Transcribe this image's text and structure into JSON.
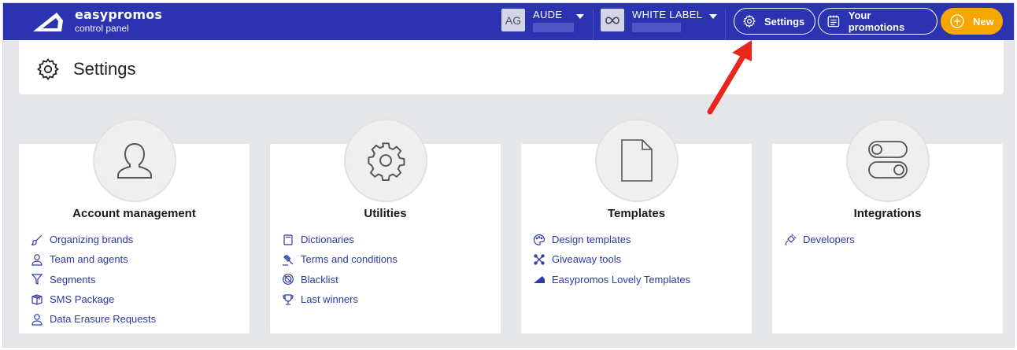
{
  "brand": {
    "name": "easypromos",
    "subtitle": "control panel"
  },
  "account": {
    "initials": "AG",
    "name": "AUDE"
  },
  "label": {
    "name": "WHITE LABEL"
  },
  "nav": {
    "settings": "Settings",
    "promotions": "Your promotions",
    "new": "New"
  },
  "page": {
    "title": "Settings"
  },
  "cards": [
    {
      "title": "Account management",
      "icon": "user-icon",
      "links": [
        {
          "label": "Organizing brands",
          "icon": "brush-icon"
        },
        {
          "label": "Team and agents",
          "icon": "user-icon"
        },
        {
          "label": "Segments",
          "icon": "filter-icon"
        },
        {
          "label": "SMS Package",
          "icon": "package-icon"
        },
        {
          "label": "Data Erasure Requests",
          "icon": "user-icon"
        }
      ]
    },
    {
      "title": "Utilities",
      "icon": "gear-icon",
      "links": [
        {
          "label": "Dictionaries",
          "icon": "book-icon"
        },
        {
          "label": "Terms and conditions",
          "icon": "gavel-icon"
        },
        {
          "label": "Blacklist",
          "icon": "ban-icon"
        },
        {
          "label": "Last winners",
          "icon": "trophy-icon"
        }
      ]
    },
    {
      "title": "Templates",
      "icon": "document-icon",
      "links": [
        {
          "label": "Design templates",
          "icon": "palette-icon"
        },
        {
          "label": "Giveaway tools",
          "icon": "tools-icon"
        },
        {
          "label": "Easypromos Lovely Templates",
          "icon": "easypromos-logo-icon"
        }
      ]
    },
    {
      "title": "Integrations",
      "icon": "toggles-icon",
      "links": [
        {
          "label": "Developers",
          "icon": "plug-icon"
        }
      ]
    }
  ],
  "colors": {
    "topbar": "#2b33b0",
    "accent": "#f7a600",
    "link": "#2f39a6",
    "annotation": "#e8271f"
  }
}
